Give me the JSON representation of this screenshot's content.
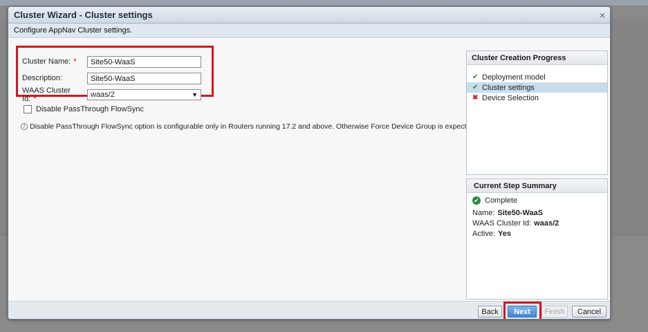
{
  "dialog": {
    "title": "Cluster Wizard - Cluster settings",
    "close_glyph": "×",
    "subtitle": "Configure AppNav Cluster settings."
  },
  "form": {
    "cluster_name_label": "Cluster Name:",
    "cluster_name_value": "Site50-WaaS",
    "description_label": "Description:",
    "description_value": "Site50-WaaS",
    "cluster_id_label": "WAAS Cluster Id:",
    "cluster_id_value": "waas/2",
    "required_mark": "*",
    "passthrough_label": "Disable PassThrough FlowSync",
    "passthrough_checked": false,
    "info_text": "Disable PassThrough FlowSync option is configurable only in Routers running 17.2 and above. Otherwise Force Device Group is expected."
  },
  "progress": {
    "title": "Cluster Creation Progress",
    "steps": [
      {
        "label": "Deployment model",
        "status": "done",
        "icon": "check-icon"
      },
      {
        "label": "Cluster settings",
        "status": "current",
        "icon": "check-icon"
      },
      {
        "label": "Device Selection",
        "status": "error",
        "icon": "x-icon"
      }
    ]
  },
  "summary": {
    "title": "Current Step Summary",
    "status": "Complete",
    "name_label": "Name:",
    "name_value": "Site50-WaaS",
    "cluster_id_label": "WAAS Cluster Id:",
    "cluster_id_value": "waas/2",
    "active_label": "Active:",
    "active_value": "Yes"
  },
  "footer": {
    "back": "Back",
    "next": "Next",
    "finish": "Finish",
    "cancel": "Cancel"
  },
  "colors": {
    "highlight_red": "#d7141c",
    "next_blue": "#3f86d1",
    "active_step_bg": "#c8dcec"
  }
}
